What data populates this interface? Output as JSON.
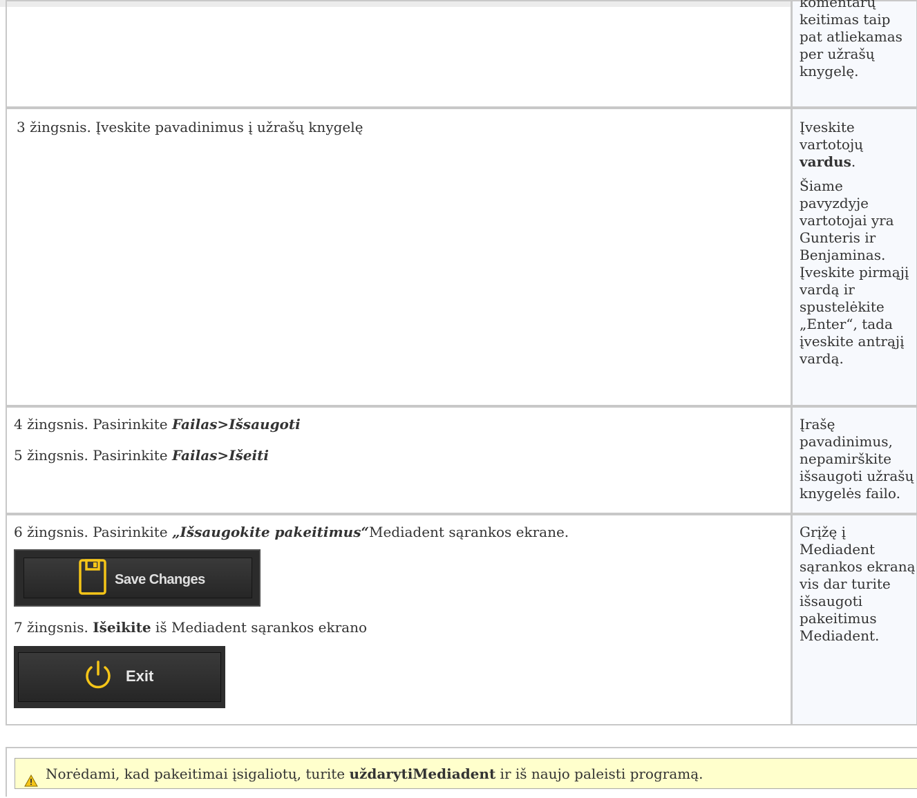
{
  "rows": [
    {
      "side": [
        "komentarų keitimas taip pat atliekamas per užrašų knygelę."
      ]
    },
    {
      "step3": "3 žingsnis. Įveskite pavadinimus į užrašų knygelę",
      "side_p1_before": "Įveskite vartotojų ",
      "side_p1_bold": "vardus",
      "side_p1_after": ".",
      "side_p2": "Šiame pavyzdyje vartotojai yra Gunteris ir Benjaminas. Įveskite pirmąjį vardą ir spustelėkite „Enter“, tada įveskite antrąjį vardą."
    },
    {
      "step4_before": "4 žingsnis. Pasirinkite ",
      "step4_bold": "Failas>Išsaugoti",
      "step5_before": "5 žingsnis. Pasirinkite ",
      "step5_bold": "Failas>Išeiti",
      "side": "Įrašę pavadinimus, nepamirškite išsaugoti užrašų knygelės failo."
    },
    {
      "step6_before": "6 žingsnis. Pasirinkite ",
      "step6_bold": "„Išsaugokite pakeitimus“",
      "step6_after": "Mediadent sąrankos ekrane.",
      "save_button_label": "Save Changes",
      "step7_before": "7 žingsnis. ",
      "step7_bold": "Išeikite",
      "step7_after": " iš Mediadent sąrankos ekrano",
      "exit_button_label": "Exit",
      "side": "Grįžę į Mediadent sąrankos ekraną vis dar turite išsaugoti pakeitimus Mediadent."
    }
  ],
  "note": {
    "icon": "warning-icon",
    "before": "Norėdami, kad pakeitimai įsigaliotų, turite ",
    "bold": "uždarytiMediadent",
    "after": " ir iš naujo paleisti programą."
  },
  "colors": {
    "accent": "#f5c518",
    "note_background": "#ffffcc",
    "side_background": "#f7f9fd",
    "border": "#c8c8c8"
  }
}
